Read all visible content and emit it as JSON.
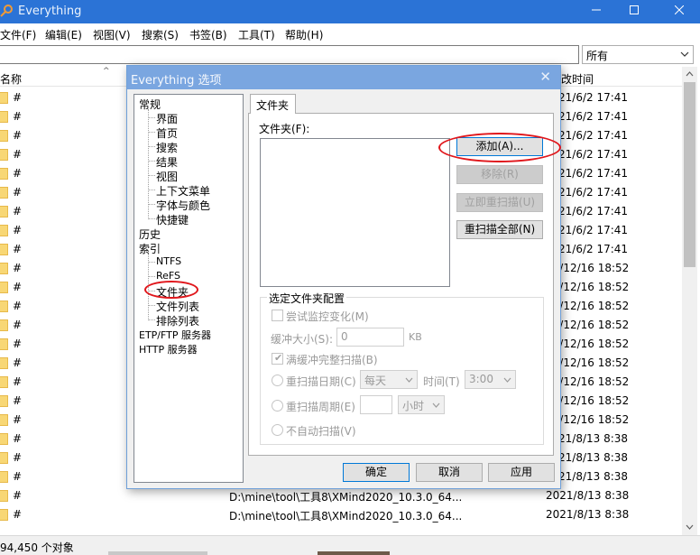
{
  "window": {
    "title": "Everything",
    "menu": [
      "文件(F)",
      "编辑(E)",
      "视图(V)",
      "搜索(S)",
      "书签(B)",
      "工具(T)",
      "帮助(H)"
    ],
    "search_value": "",
    "filter_value": "所有",
    "columns": {
      "name": "名称",
      "date": "改时间"
    },
    "rows": [
      {
        "name": "#",
        "path": "",
        "date": "21/6/2 17:41"
      },
      {
        "name": "#",
        "path": "",
        "date": "21/6/2 17:41"
      },
      {
        "name": "#",
        "path": "",
        "date": "21/6/2 17:41"
      },
      {
        "name": "#",
        "path": "",
        "date": "21/6/2 17:41"
      },
      {
        "name": "#",
        "path": "",
        "date": "21/6/2 17:41"
      },
      {
        "name": "#",
        "path": "",
        "date": "21/6/2 17:41"
      },
      {
        "name": "#",
        "path": "",
        "date": "21/6/2 17:41"
      },
      {
        "name": "#",
        "path": "",
        "date": "21/6/2 17:41"
      },
      {
        "name": "#",
        "path": "",
        "date": "21/6/2 17:41"
      },
      {
        "name": "#",
        "path": "",
        "date": "20/12/16 18:52"
      },
      {
        "name": "#",
        "path": "",
        "date": "20/12/16 18:52"
      },
      {
        "name": "#",
        "path": "",
        "date": "20/12/16 18:52"
      },
      {
        "name": "#",
        "path": "",
        "date": "20/12/16 18:52"
      },
      {
        "name": "#",
        "path": "",
        "date": "20/12/16 18:52"
      },
      {
        "name": "#",
        "path": "",
        "date": "20/12/16 18:52"
      },
      {
        "name": "#",
        "path": "",
        "date": "20/12/16 18:52"
      },
      {
        "name": "#",
        "path": "",
        "date": "20/12/16 18:52"
      },
      {
        "name": "#",
        "path": "",
        "date": "20/12/16 18:52"
      },
      {
        "name": "#",
        "path": "",
        "date": "21/8/13 8:38"
      },
      {
        "name": "#",
        "path": "",
        "date": "21/8/13 8:38"
      },
      {
        "name": "#",
        "path": "",
        "date": "21/8/13 8:38"
      },
      {
        "name": "#",
        "path": "D:\\mine\\tool\\工具8\\XMind2020_10.3.0_64...",
        "date": "2021/8/13 8:38"
      },
      {
        "name": "#",
        "path": "D:\\mine\\tool\\工具8\\XMind2020_10.3.0_64...",
        "date": "2021/8/13 8:38"
      }
    ],
    "status": "94,450 个对象"
  },
  "dialog": {
    "title": "Everything 选项",
    "tree": {
      "general": "常规",
      "general_children": [
        "界面",
        "首页",
        "搜索",
        "结果",
        "视图",
        "上下文菜单",
        "字体与颜色",
        "快捷键"
      ],
      "history": "历史",
      "index": "索引",
      "index_children": [
        "NTFS",
        "ReFS",
        "文件夹",
        "文件列表",
        "排除列表"
      ],
      "etp": "ETP/FTP 服务器",
      "http": "HTTP 服务器"
    },
    "tab": "文件夹",
    "folders_label": "文件夹(F):",
    "buttons": {
      "add": "添加(A)...",
      "remove": "移除(R)",
      "rescan_now": "立即重扫描(U)",
      "rescan_all": "重扫描全部(N)"
    },
    "group": {
      "title": "选定文件夹配置",
      "monitor": "尝试监控变化(M)",
      "buffer_label": "缓冲大小(S):",
      "buffer_value": "0",
      "buffer_unit": "KB",
      "full_rescan": "满缓冲完整扫描(B)",
      "daily": "重扫描日期(C)",
      "daily_value": "每天",
      "time_label": "时间(T)",
      "time_value": "3:00",
      "period": "重扫描周期(E)",
      "period_value": "",
      "period_unit": "小时",
      "no_auto": "不自动扫描(V)"
    },
    "footer": {
      "ok": "确定",
      "cancel": "取消",
      "apply": "应用"
    }
  },
  "colors": {
    "titlebar": "#2b73d6",
    "annotation": "#e0161b"
  }
}
